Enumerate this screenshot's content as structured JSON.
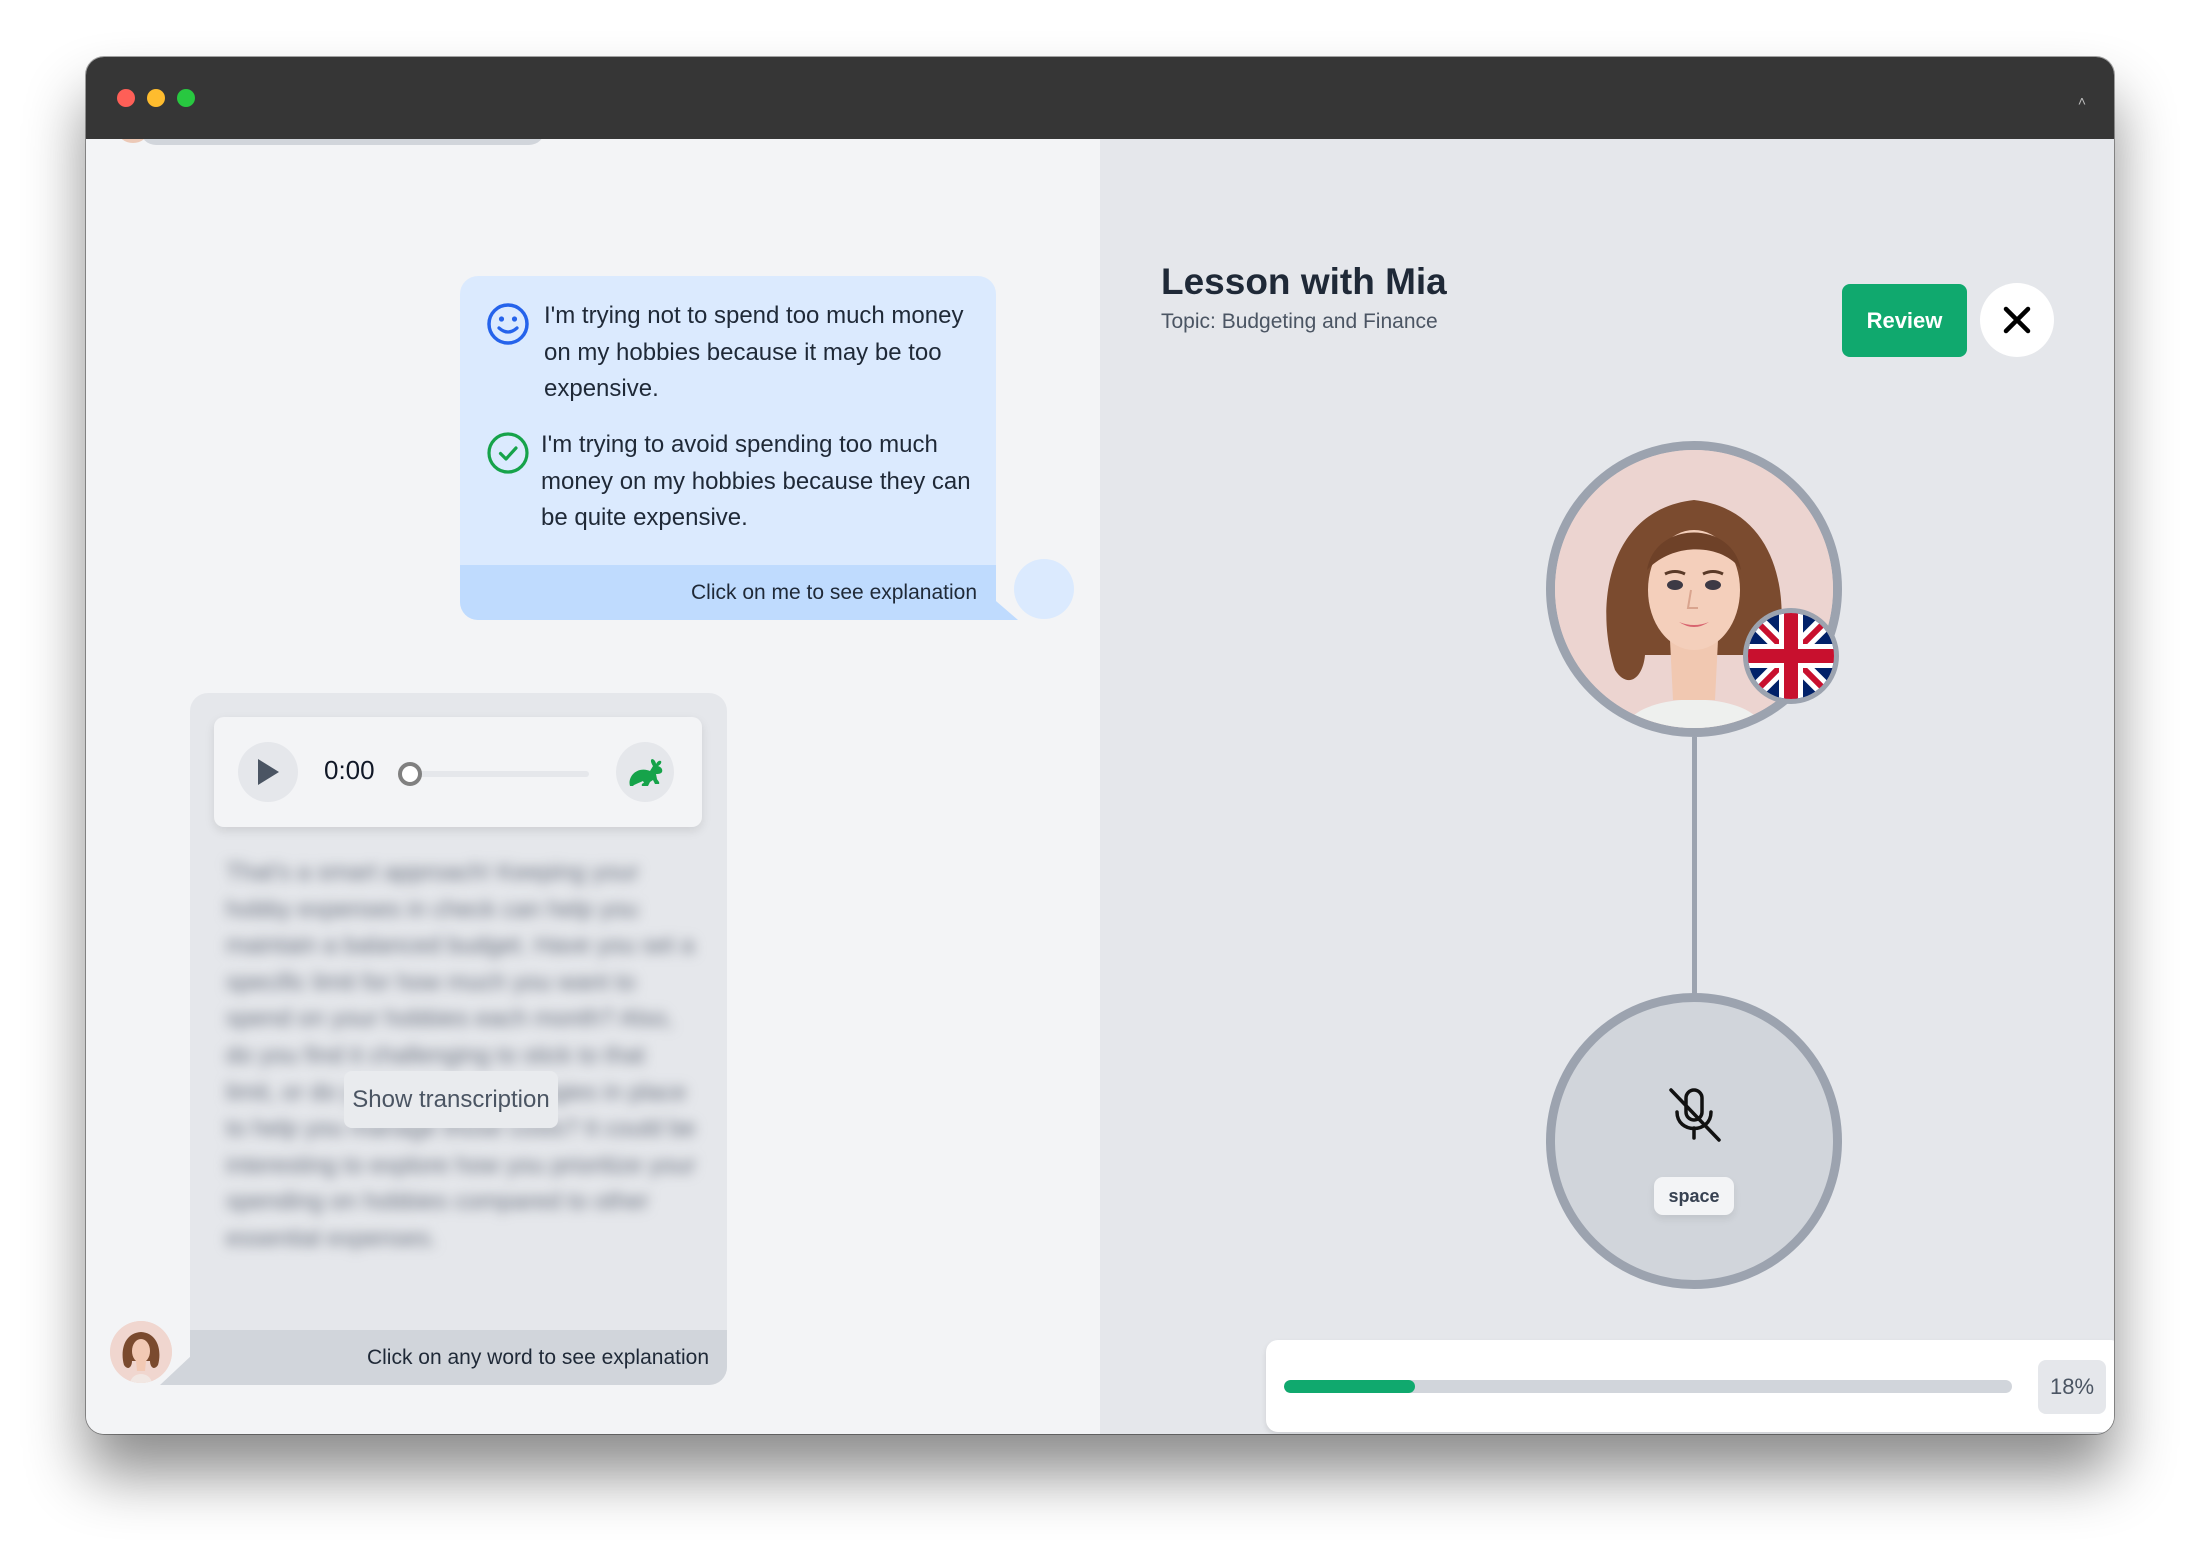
{
  "window": {
    "traffic_lights": [
      "close",
      "minimize",
      "maximize"
    ]
  },
  "chat": {
    "user_message": {
      "original_icon": "smiley-face-icon",
      "original_text": "I'm trying not to spend too much money on my hobbies because it may be too expensive.",
      "corrected_icon": "check-circle-icon",
      "corrected_text": "I'm trying to avoid spending too much money on my hobbies because they can be quite expensive.",
      "footer": "Click on me to see explanation",
      "colors": {
        "bubble": "#dbeafe",
        "footer": "#bfdbfe",
        "smiley": "#2563eb",
        "check": "#16a34a"
      }
    },
    "bot_message": {
      "audio": {
        "time": "0:00",
        "progress": 0,
        "play_icon": "play-icon",
        "speed_icon": "rabbit-icon"
      },
      "blurred_transcript": "That's a smart approach! Keeping your hobby expenses in check can help you maintain a balanced budget. Have you set a specific limit for how much you want to spend on your hobbies each month? Also, do you find it challenging to stick to that limit, or do you have any strategies in place to help you manage those costs? It could be interesting to explore how you prioritize your spending on hobbies compared to other essential expenses.",
      "show_transcription_label": "Show transcription",
      "footer": "Click on any word to see explanation"
    }
  },
  "lesson": {
    "title": "Lesson with Mia",
    "topic": "Topic: Budgeting and Finance",
    "review_label": "Review",
    "close_icon": "close-icon",
    "tutor_language_flag": "uk-flag-icon",
    "mic_state": "muted",
    "mic_shortcut": "space",
    "progress_percent": 18,
    "progress_label": "18%",
    "colors": {
      "accent": "#10a96e"
    }
  }
}
